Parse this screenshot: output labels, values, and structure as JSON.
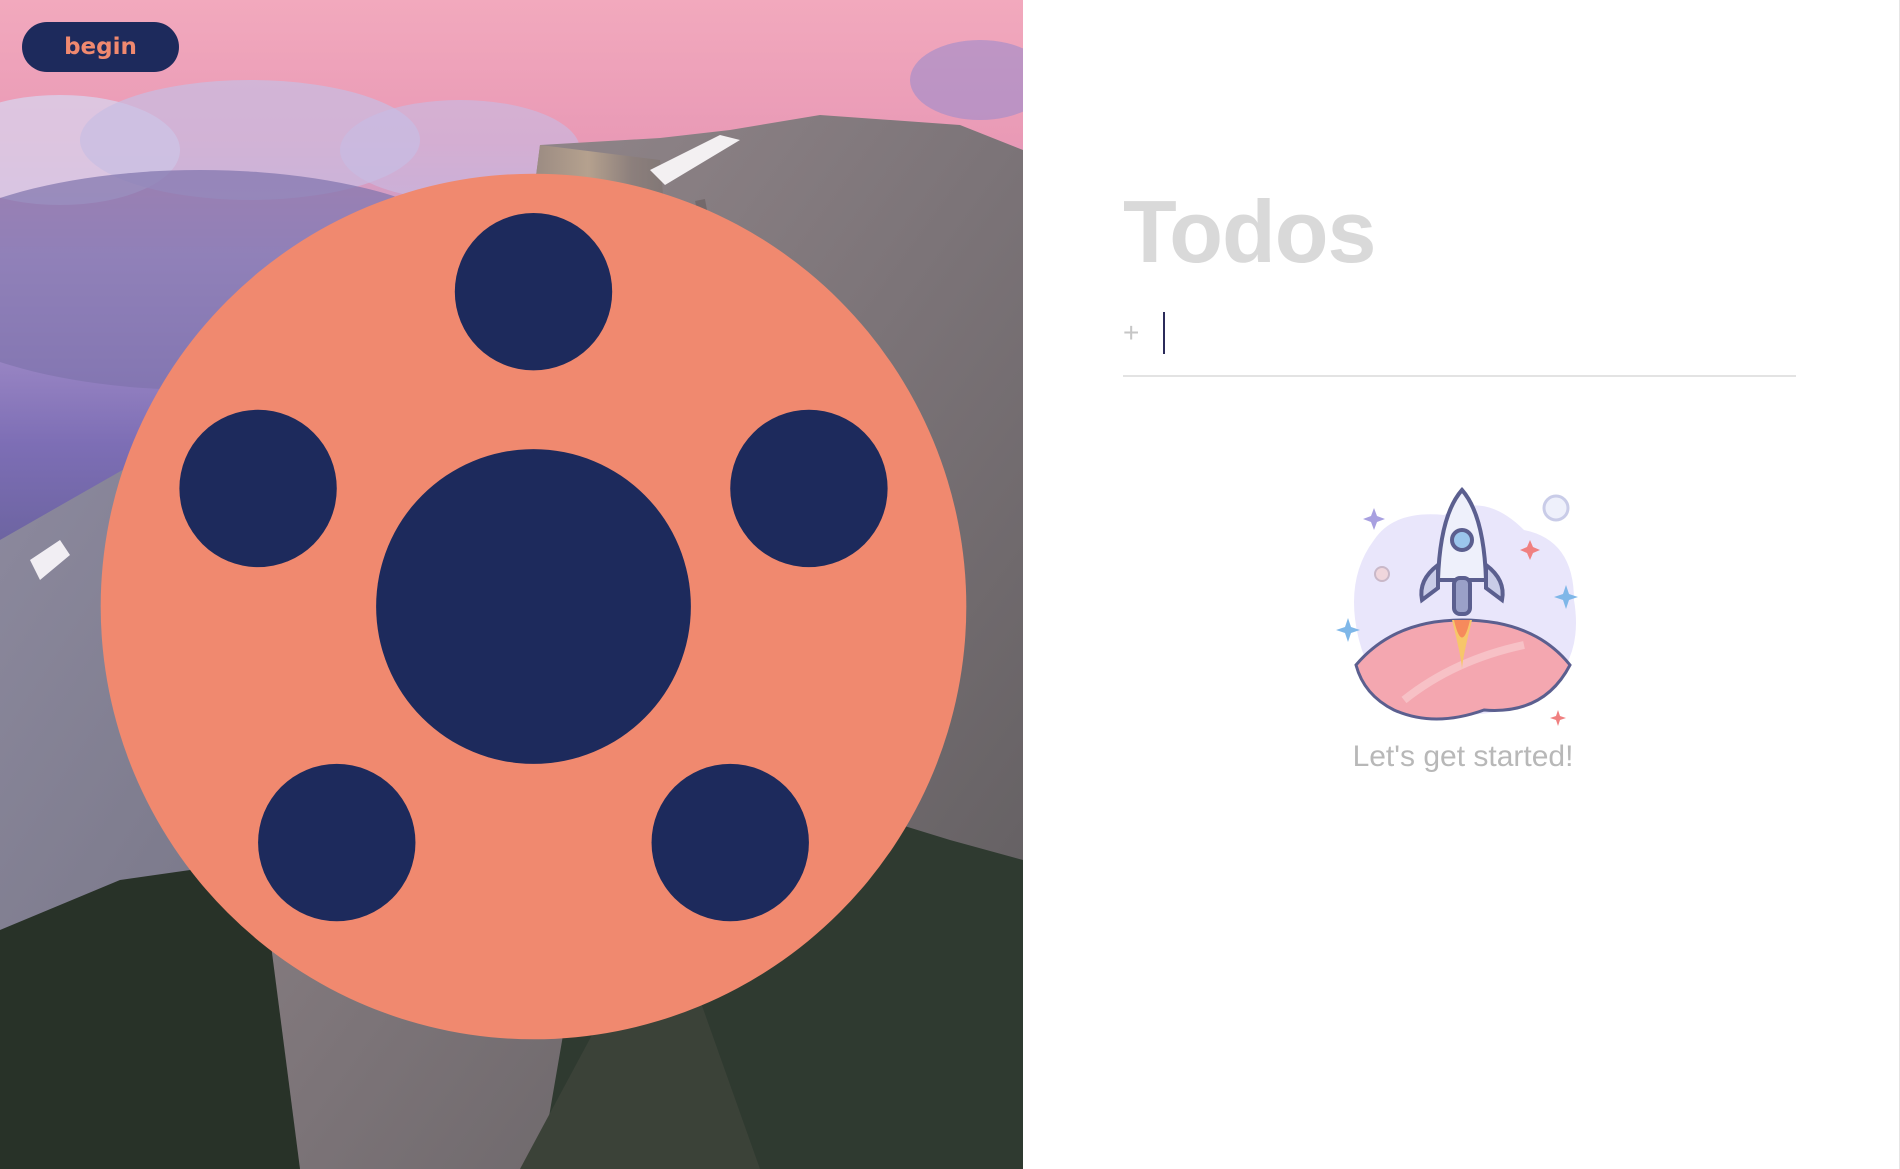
{
  "hero": {
    "image_label": "mountain-photo"
  },
  "brand": {
    "label": "begin",
    "icon": "begin-logo-icon",
    "color": "#1d2a5c",
    "accent": "#f0896f"
  },
  "todos": {
    "title": "Todos",
    "add_icon": "+",
    "input_value": "",
    "input_placeholder": ""
  },
  "empty_state": {
    "illustration": "rocket-illustration-icon",
    "message": "Let's get started!"
  }
}
